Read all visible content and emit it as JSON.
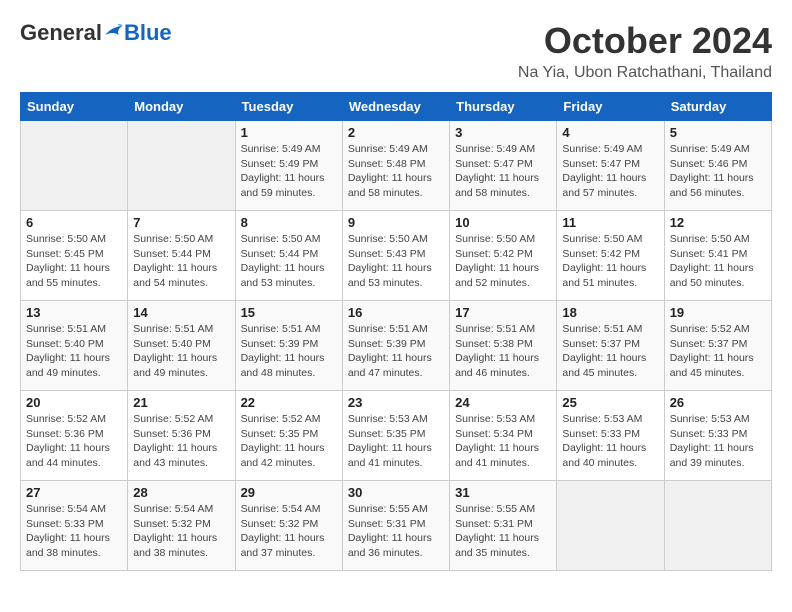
{
  "header": {
    "logo_general": "General",
    "logo_blue": "Blue",
    "month_title": "October 2024",
    "location": "Na Yia, Ubon Ratchathani, Thailand"
  },
  "calendar": {
    "days_of_week": [
      "Sunday",
      "Monday",
      "Tuesday",
      "Wednesday",
      "Thursday",
      "Friday",
      "Saturday"
    ],
    "weeks": [
      [
        {
          "day": "",
          "detail": ""
        },
        {
          "day": "",
          "detail": ""
        },
        {
          "day": "1",
          "detail": "Sunrise: 5:49 AM\nSunset: 5:49 PM\nDaylight: 11 hours and 59 minutes."
        },
        {
          "day": "2",
          "detail": "Sunrise: 5:49 AM\nSunset: 5:48 PM\nDaylight: 11 hours and 58 minutes."
        },
        {
          "day": "3",
          "detail": "Sunrise: 5:49 AM\nSunset: 5:47 PM\nDaylight: 11 hours and 58 minutes."
        },
        {
          "day": "4",
          "detail": "Sunrise: 5:49 AM\nSunset: 5:47 PM\nDaylight: 11 hours and 57 minutes."
        },
        {
          "day": "5",
          "detail": "Sunrise: 5:49 AM\nSunset: 5:46 PM\nDaylight: 11 hours and 56 minutes."
        }
      ],
      [
        {
          "day": "6",
          "detail": "Sunrise: 5:50 AM\nSunset: 5:45 PM\nDaylight: 11 hours and 55 minutes."
        },
        {
          "day": "7",
          "detail": "Sunrise: 5:50 AM\nSunset: 5:44 PM\nDaylight: 11 hours and 54 minutes."
        },
        {
          "day": "8",
          "detail": "Sunrise: 5:50 AM\nSunset: 5:44 PM\nDaylight: 11 hours and 53 minutes."
        },
        {
          "day": "9",
          "detail": "Sunrise: 5:50 AM\nSunset: 5:43 PM\nDaylight: 11 hours and 53 minutes."
        },
        {
          "day": "10",
          "detail": "Sunrise: 5:50 AM\nSunset: 5:42 PM\nDaylight: 11 hours and 52 minutes."
        },
        {
          "day": "11",
          "detail": "Sunrise: 5:50 AM\nSunset: 5:42 PM\nDaylight: 11 hours and 51 minutes."
        },
        {
          "day": "12",
          "detail": "Sunrise: 5:50 AM\nSunset: 5:41 PM\nDaylight: 11 hours and 50 minutes."
        }
      ],
      [
        {
          "day": "13",
          "detail": "Sunrise: 5:51 AM\nSunset: 5:40 PM\nDaylight: 11 hours and 49 minutes."
        },
        {
          "day": "14",
          "detail": "Sunrise: 5:51 AM\nSunset: 5:40 PM\nDaylight: 11 hours and 49 minutes."
        },
        {
          "day": "15",
          "detail": "Sunrise: 5:51 AM\nSunset: 5:39 PM\nDaylight: 11 hours and 48 minutes."
        },
        {
          "day": "16",
          "detail": "Sunrise: 5:51 AM\nSunset: 5:39 PM\nDaylight: 11 hours and 47 minutes."
        },
        {
          "day": "17",
          "detail": "Sunrise: 5:51 AM\nSunset: 5:38 PM\nDaylight: 11 hours and 46 minutes."
        },
        {
          "day": "18",
          "detail": "Sunrise: 5:51 AM\nSunset: 5:37 PM\nDaylight: 11 hours and 45 minutes."
        },
        {
          "day": "19",
          "detail": "Sunrise: 5:52 AM\nSunset: 5:37 PM\nDaylight: 11 hours and 45 minutes."
        }
      ],
      [
        {
          "day": "20",
          "detail": "Sunrise: 5:52 AM\nSunset: 5:36 PM\nDaylight: 11 hours and 44 minutes."
        },
        {
          "day": "21",
          "detail": "Sunrise: 5:52 AM\nSunset: 5:36 PM\nDaylight: 11 hours and 43 minutes."
        },
        {
          "day": "22",
          "detail": "Sunrise: 5:52 AM\nSunset: 5:35 PM\nDaylight: 11 hours and 42 minutes."
        },
        {
          "day": "23",
          "detail": "Sunrise: 5:53 AM\nSunset: 5:35 PM\nDaylight: 11 hours and 41 minutes."
        },
        {
          "day": "24",
          "detail": "Sunrise: 5:53 AM\nSunset: 5:34 PM\nDaylight: 11 hours and 41 minutes."
        },
        {
          "day": "25",
          "detail": "Sunrise: 5:53 AM\nSunset: 5:33 PM\nDaylight: 11 hours and 40 minutes."
        },
        {
          "day": "26",
          "detail": "Sunrise: 5:53 AM\nSunset: 5:33 PM\nDaylight: 11 hours and 39 minutes."
        }
      ],
      [
        {
          "day": "27",
          "detail": "Sunrise: 5:54 AM\nSunset: 5:33 PM\nDaylight: 11 hours and 38 minutes."
        },
        {
          "day": "28",
          "detail": "Sunrise: 5:54 AM\nSunset: 5:32 PM\nDaylight: 11 hours and 38 minutes."
        },
        {
          "day": "29",
          "detail": "Sunrise: 5:54 AM\nSunset: 5:32 PM\nDaylight: 11 hours and 37 minutes."
        },
        {
          "day": "30",
          "detail": "Sunrise: 5:55 AM\nSunset: 5:31 PM\nDaylight: 11 hours and 36 minutes."
        },
        {
          "day": "31",
          "detail": "Sunrise: 5:55 AM\nSunset: 5:31 PM\nDaylight: 11 hours and 35 minutes."
        },
        {
          "day": "",
          "detail": ""
        },
        {
          "day": "",
          "detail": ""
        }
      ]
    ]
  }
}
